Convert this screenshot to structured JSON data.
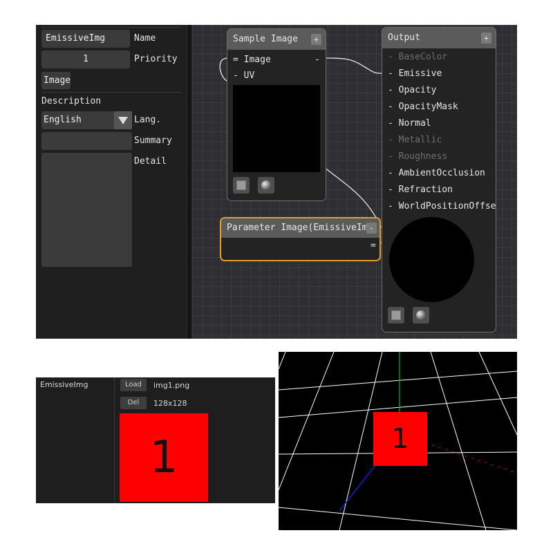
{
  "properties": {
    "name_value": "EmissiveImg",
    "name_label": "Name",
    "priority_value": "1",
    "priority_label": "Priority",
    "type_button": "Image",
    "description_label": "Description",
    "language_value": "English",
    "language_label": "Lang.",
    "summary_label": "Summary",
    "detail_label": "Detail"
  },
  "sample_node": {
    "title": "Sample Image",
    "add_button": "+",
    "inputs": [
      "= Image",
      "- UV"
    ],
    "output_pin": "-"
  },
  "param_node": {
    "title": "Parameter Image(EmissiveImg)",
    "collapse_button": "-",
    "output_pin": "="
  },
  "output_node": {
    "title": "Output",
    "add_button": "+",
    "pins": [
      {
        "label": "- BaseColor",
        "enabled": false
      },
      {
        "label": "- Emissive",
        "enabled": true
      },
      {
        "label": "- Opacity",
        "enabled": true
      },
      {
        "label": "- OpacityMask",
        "enabled": true
      },
      {
        "label": "- Normal",
        "enabled": true
      },
      {
        "label": "- Metallic",
        "enabled": false
      },
      {
        "label": "- Roughness",
        "enabled": false
      },
      {
        "label": "- AmbientOcclusion",
        "enabled": true
      },
      {
        "label": "- Refraction",
        "enabled": true
      },
      {
        "label": "- WorldPositionOffset",
        "enabled": true
      }
    ]
  },
  "material_panel": {
    "param_name": "EmissiveImg",
    "load_button": "Load",
    "delete_button": "Del",
    "file_name": "img1.png",
    "file_size": "128x128",
    "texture_text": "1"
  },
  "viewport": {
    "cube_text": "1"
  },
  "colors": {
    "texture": "#ff0000",
    "selected_node_border": "#e0a030",
    "axis_y": "#00c000",
    "axis_z": "#2020ff",
    "axis_x": "#ff2020",
    "grid": "#ffffff"
  },
  "icons": [
    "dropdown-triangle-icon",
    "flat-preview-icon",
    "sphere-preview-icon"
  ]
}
